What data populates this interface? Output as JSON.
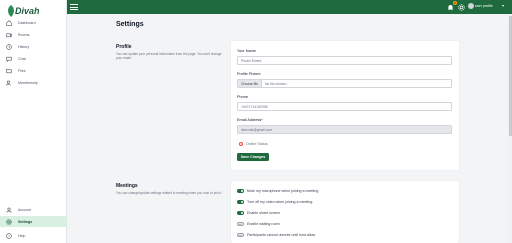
{
  "app": {
    "brand": "Divah"
  },
  "sidebar": {
    "items": [
      {
        "label": "Dashboard",
        "icon": "home-icon",
        "active": false
      },
      {
        "label": "Rooms",
        "icon": "video-icon",
        "active": false
      },
      {
        "label": "History",
        "icon": "clock-icon",
        "active": false
      },
      {
        "label": "Chat",
        "icon": "chat-icon",
        "active": false
      },
      {
        "label": "Files",
        "icon": "folder-icon",
        "active": false
      },
      {
        "label": "Membership",
        "icon": "users-icon",
        "active": false
      }
    ],
    "bottom": [
      {
        "label": "Account",
        "icon": "user-icon",
        "active": false
      },
      {
        "label": "Settings",
        "icon": "gear-icon",
        "active": true
      },
      {
        "label": "Help",
        "icon": "help-icon",
        "active": false
      }
    ]
  },
  "topbar": {
    "notification_count": "0",
    "profile_label": "user profile",
    "accent": "#1f6b3f"
  },
  "page": {
    "title": "Settings"
  },
  "profile": {
    "title": "Profile",
    "description": "You can update your personal information from the page. You can't change your email.",
    "name_label": "Your Name",
    "name_value": "Prudin Divent",
    "picture_label": "Profile Picture",
    "choose_file_label": "Choose file",
    "no_file_label": "No file chosen",
    "phone_label": "Phone",
    "phone_value": "+6471714152098",
    "email_label": "Email Address*",
    "email_value": "divnvolk@gmail.com",
    "status_label": "Online Status",
    "save_label": "Save Changes"
  },
  "meetings": {
    "title": "Meetings",
    "description": "You can change/update settings related to meeting when you host or join it.",
    "options": [
      {
        "label": "Mute my microphone when joining a meeting",
        "on": true
      },
      {
        "label": "Turn off my video when joining a meeting",
        "on": true
      },
      {
        "label": "Enable share screen",
        "on": true
      },
      {
        "label": "Enable waiting room",
        "on": false
      },
      {
        "label": "Participants cannot unmute until host allow",
        "on": false
      }
    ]
  }
}
